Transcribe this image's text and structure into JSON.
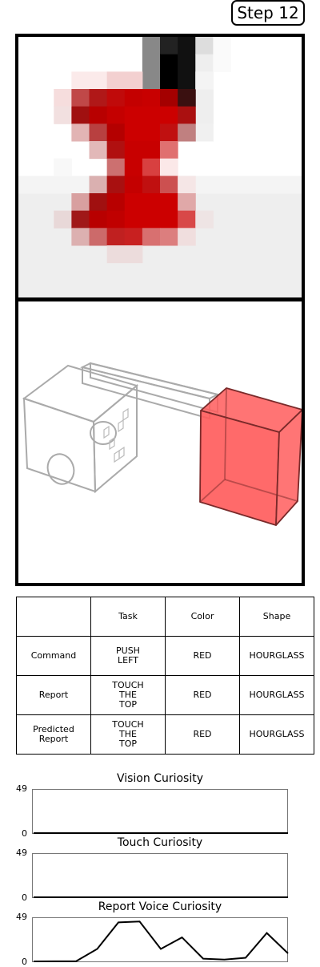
{
  "step_label": "Step 12",
  "vision": {
    "grid_cols": 16,
    "grid_rows": 15,
    "blocks": [
      [
        0,
        0,
        16,
        15,
        "#ffffff"
      ],
      [
        0,
        9,
        16,
        6,
        "#eeeeee"
      ],
      [
        0,
        8,
        16,
        1,
        "#f4f4f4"
      ],
      [
        7,
        0,
        1,
        5,
        "#888888"
      ],
      [
        8,
        0,
        1,
        1,
        "#222222"
      ],
      [
        8,
        1,
        1,
        2,
        "#000000"
      ],
      [
        9,
        0,
        1,
        4,
        "#111111"
      ],
      [
        10,
        0,
        1,
        1,
        "#dddddd"
      ],
      [
        10,
        1,
        1,
        4,
        "#eeeeee"
      ],
      [
        10,
        5,
        1,
        1,
        "#f0f0f0"
      ],
      [
        3,
        2,
        2,
        1,
        "#fbeaea"
      ],
      [
        5,
        2,
        2,
        1,
        "#f3d0d0"
      ],
      [
        2,
        3,
        1,
        1,
        "#f6dddd"
      ],
      [
        3,
        3,
        1,
        1,
        "#c04848"
      ],
      [
        4,
        3,
        1,
        1,
        "#b01818"
      ],
      [
        5,
        3,
        1,
        1,
        "#c00a0a"
      ],
      [
        6,
        3,
        1,
        1,
        "#c40000"
      ],
      [
        7,
        3,
        1,
        1,
        "#c80000"
      ],
      [
        8,
        3,
        1,
        1,
        "#a40000"
      ],
      [
        9,
        3,
        1,
        1,
        "#3a1010"
      ],
      [
        2,
        4,
        1,
        1,
        "#f2e0e0"
      ],
      [
        3,
        4,
        1,
        1,
        "#a01010"
      ],
      [
        4,
        4,
        1,
        1,
        "#b80000"
      ],
      [
        5,
        4,
        1,
        1,
        "#c40000"
      ],
      [
        6,
        4,
        3,
        1,
        "#cc0000"
      ],
      [
        9,
        4,
        1,
        1,
        "#aa1010"
      ],
      [
        3,
        5,
        1,
        1,
        "#e2b4b4"
      ],
      [
        4,
        5,
        1,
        1,
        "#b84040"
      ],
      [
        5,
        5,
        1,
        1,
        "#b40000"
      ],
      [
        6,
        5,
        2,
        1,
        "#cc0000"
      ],
      [
        8,
        5,
        1,
        1,
        "#c01010"
      ],
      [
        9,
        5,
        1,
        1,
        "#c08080"
      ],
      [
        4,
        6,
        1,
        1,
        "#e2b8b8"
      ],
      [
        5,
        6,
        1,
        1,
        "#b01010"
      ],
      [
        6,
        6,
        2,
        1,
        "#c80000"
      ],
      [
        8,
        6,
        1,
        1,
        "#e07070"
      ],
      [
        5,
        7,
        1,
        1,
        "#cc7070"
      ],
      [
        6,
        7,
        1,
        1,
        "#c80000"
      ],
      [
        7,
        7,
        1,
        1,
        "#d84040"
      ],
      [
        8,
        7,
        1,
        1,
        "#fbe8e8"
      ],
      [
        4,
        8,
        1,
        1,
        "#dab0b0"
      ],
      [
        5,
        8,
        1,
        1,
        "#a81010"
      ],
      [
        6,
        8,
        1,
        1,
        "#c40000"
      ],
      [
        7,
        8,
        1,
        1,
        "#c01010"
      ],
      [
        8,
        8,
        1,
        1,
        "#cc5050"
      ],
      [
        9,
        8,
        1,
        1,
        "#f5e6e6"
      ],
      [
        3,
        9,
        1,
        1,
        "#d8a0a0"
      ],
      [
        4,
        9,
        1,
        1,
        "#a01010"
      ],
      [
        5,
        9,
        1,
        1,
        "#b80000"
      ],
      [
        6,
        9,
        3,
        1,
        "#cc0000"
      ],
      [
        9,
        9,
        1,
        1,
        "#e0a8a8"
      ],
      [
        2,
        10,
        1,
        1,
        "#e8d8d8"
      ],
      [
        3,
        10,
        1,
        1,
        "#a01818"
      ],
      [
        4,
        10,
        1,
        1,
        "#b80000"
      ],
      [
        5,
        10,
        1,
        1,
        "#c00000"
      ],
      [
        6,
        10,
        3,
        1,
        "#cc0000"
      ],
      [
        9,
        10,
        1,
        1,
        "#d84848"
      ],
      [
        10,
        10,
        1,
        1,
        "#eee4e4"
      ],
      [
        3,
        11,
        1,
        1,
        "#dcb0b0"
      ],
      [
        4,
        11,
        1,
        1,
        "#cc6a6a"
      ],
      [
        5,
        11,
        1,
        1,
        "#c02020"
      ],
      [
        6,
        11,
        1,
        1,
        "#c82020"
      ],
      [
        7,
        11,
        1,
        1,
        "#d87070"
      ],
      [
        8,
        11,
        1,
        1,
        "#dc7e7e"
      ],
      [
        9,
        11,
        1,
        1,
        "#f0dede"
      ],
      [
        5,
        12,
        2,
        1,
        "#ecdcdc"
      ],
      [
        2,
        7,
        1,
        1,
        "#f8f8f8"
      ],
      [
        10,
        2,
        1,
        1,
        "#f4f4f4"
      ],
      [
        11,
        0,
        1,
        2,
        "#fafafa"
      ]
    ]
  },
  "table": {
    "header": [
      "",
      "Task",
      "Color",
      "Shape"
    ],
    "rows": [
      {
        "label": "Command",
        "task": "PUSH\nLEFT",
        "color": "RED",
        "shape": "HOURGLASS"
      },
      {
        "label": "Report",
        "task": "TOUCH\nTHE\nTOP",
        "color": "RED",
        "shape": "HOURGLASS"
      },
      {
        "label": "Predicted\nReport",
        "task": "TOUCH\nTHE\nTOP",
        "color": "RED",
        "shape": "HOURGLASS"
      }
    ]
  },
  "chart_data": [
    {
      "type": "line",
      "title": "Vision Curiosity",
      "ylim": [
        0,
        49
      ],
      "yticks": [
        "49",
        "0"
      ],
      "values": [
        0,
        0,
        0,
        0,
        0,
        0,
        0,
        0,
        0,
        0,
        0,
        0,
        0,
        0
      ]
    },
    {
      "type": "line",
      "title": "Touch Curiosity",
      "ylim": [
        0,
        49
      ],
      "yticks": [
        "49",
        "0"
      ],
      "values": [
        0,
        0,
        0,
        0,
        0,
        0,
        0,
        0,
        0,
        0,
        0,
        0,
        0,
        0
      ]
    },
    {
      "type": "line",
      "title": "Report Voice Curiosity",
      "ylim": [
        0,
        49
      ],
      "yticks": [
        "49",
        "0"
      ],
      "values": [
        0,
        1,
        1,
        15,
        45,
        46,
        15,
        28,
        4,
        3,
        5,
        33,
        10
      ]
    }
  ],
  "colors": {
    "cube_red": "#ff3333",
    "wireframe": "#aaaaaa",
    "line": "#000000"
  }
}
